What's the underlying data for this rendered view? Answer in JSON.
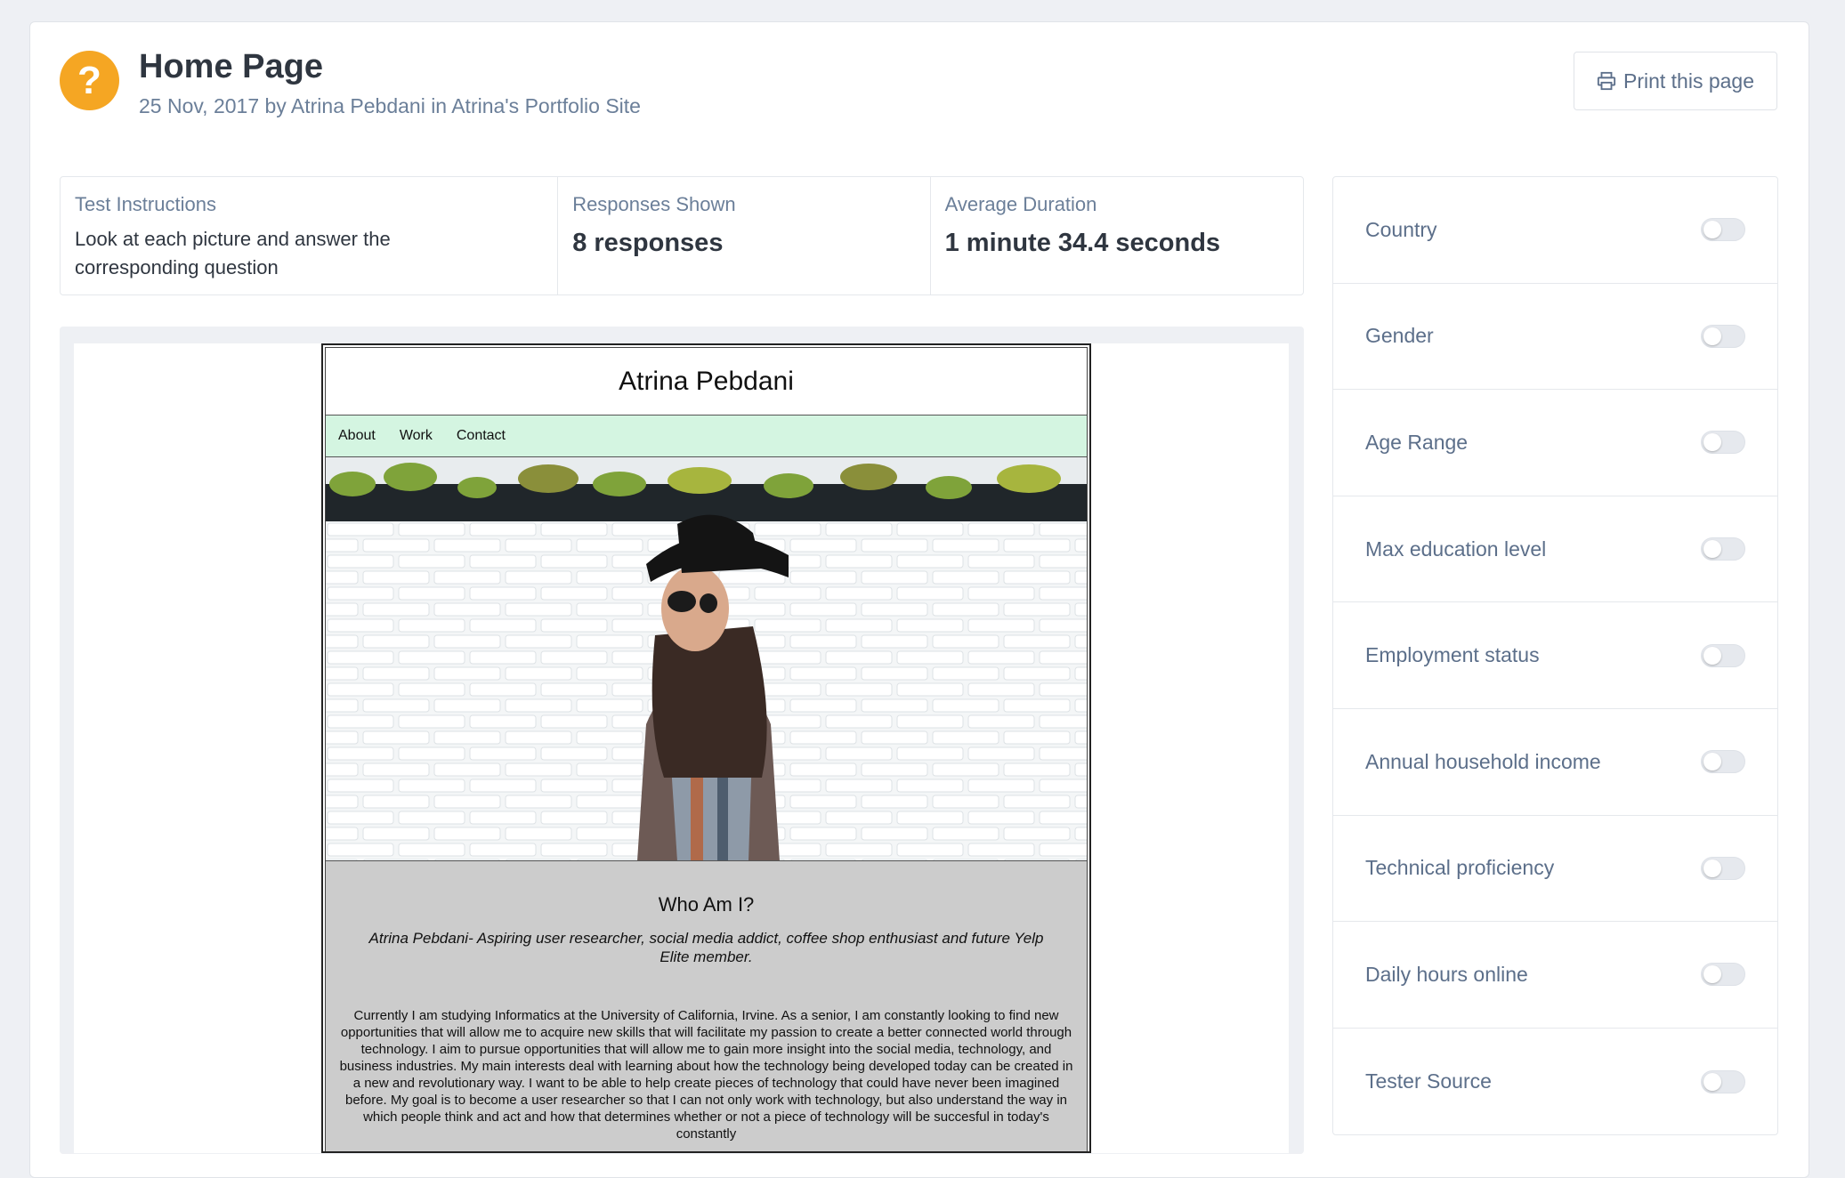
{
  "header": {
    "title": "Home Page",
    "meta": "25 Nov, 2017 by Atrina Pebdani in Atrina's Portfolio Site",
    "print_label": "Print this page",
    "accent": "#f5a623"
  },
  "stats": {
    "instructions_label": "Test Instructions",
    "instructions_text": "Look at each picture and answer the corresponding question",
    "responses_label": "Responses Shown",
    "responses_value": "8 responses",
    "duration_label": "Average Duration",
    "duration_value": "1 minute 34.4 seconds"
  },
  "preview": {
    "site_title": "Atrina Pebdani",
    "nav": [
      "About",
      "Work",
      "Contact"
    ],
    "about_heading": "Who Am I?",
    "about_tagline": "Atrina Pebdani- Aspiring user researcher, social media addict, coffee shop enthusiast and future Yelp Elite member.",
    "about_body": "Currently I am studying Informatics at the University of California, Irvine. As a senior, I am constantly looking to find new opportunities that will allow me to acquire new skills that will facilitate my passion to create a better connected world through technology. I aim to pursue opportunities that will allow me to gain more insight into the social media, technology, and business industries. My main interests deal with learning about how the technology being developed today can be created in a new and revolutionary way. I want to be able to help create pieces of technology that could have never been imagined before. My goal is to become a user researcher so that I can not only work with technology, but also understand the way in which people think and act and how that determines whether or not a piece of technology will be succesful in today's constantly"
  },
  "filters": [
    {
      "label": "Country",
      "on": false
    },
    {
      "label": "Gender",
      "on": false
    },
    {
      "label": "Age Range",
      "on": false
    },
    {
      "label": "Max education level",
      "on": false
    },
    {
      "label": "Employment status",
      "on": false
    },
    {
      "label": "Annual household income",
      "on": false
    },
    {
      "label": "Technical proficiency",
      "on": false
    },
    {
      "label": "Daily hours online",
      "on": false
    },
    {
      "label": "Tester Source",
      "on": false
    }
  ]
}
